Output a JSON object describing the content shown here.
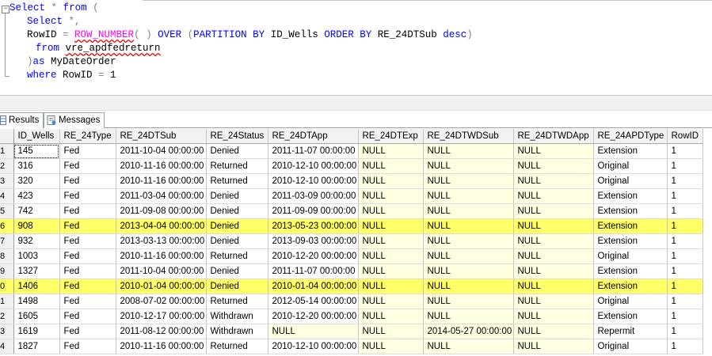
{
  "editor": {
    "lines": [
      {
        "indent": 0,
        "tokens": [
          {
            "t": "Select",
            "c": "kw"
          },
          {
            "t": " ",
            "c": ""
          },
          {
            "t": "*",
            "c": "op"
          },
          {
            "t": " ",
            "c": ""
          },
          {
            "t": "from",
            "c": "kw"
          },
          {
            "t": " ",
            "c": ""
          },
          {
            "t": "(",
            "c": "op"
          }
        ]
      },
      {
        "indent": 2,
        "tokens": [
          {
            "t": "Select",
            "c": "kw"
          },
          {
            "t": " ",
            "c": ""
          },
          {
            "t": "*,",
            "c": "op"
          }
        ]
      },
      {
        "indent": 2,
        "tokens": [
          {
            "t": "RowID ",
            "c": ""
          },
          {
            "t": "=",
            "c": "op"
          },
          {
            "t": " ",
            "c": ""
          },
          {
            "t": "ROW_NUMBER",
            "c": "fn sq"
          },
          {
            "t": "(",
            "c": "op"
          },
          {
            "t": " ",
            "c": ""
          },
          {
            "t": ")",
            "c": "op"
          },
          {
            "t": " ",
            "c": ""
          },
          {
            "t": "OVER",
            "c": "kw"
          },
          {
            "t": " ",
            "c": ""
          },
          {
            "t": "(",
            "c": "op"
          },
          {
            "t": "PARTITION BY",
            "c": "kw"
          },
          {
            "t": " ID_Wells ",
            "c": ""
          },
          {
            "t": "ORDER BY",
            "c": "kw"
          },
          {
            "t": " RE_24DTSub ",
            "c": ""
          },
          {
            "t": "desc",
            "c": "kw"
          },
          {
            "t": ")",
            "c": "op"
          }
        ]
      },
      {
        "indent": 3,
        "tokens": [
          {
            "t": "from",
            "c": "kw"
          },
          {
            "t": " ",
            "c": ""
          },
          {
            "t": "vre_apdfedreturn",
            "c": "sq"
          }
        ]
      },
      {
        "indent": 2,
        "tokens": [
          {
            "t": ")",
            "c": "op"
          },
          {
            "t": "as",
            "c": "kw"
          },
          {
            "t": " MyDateOrder",
            "c": ""
          }
        ]
      },
      {
        "indent": 2,
        "tokens": [
          {
            "t": "where",
            "c": "kw"
          },
          {
            "t": " RowID ",
            "c": ""
          },
          {
            "t": "=",
            "c": "op"
          },
          {
            "t": " 1",
            "c": ""
          }
        ]
      }
    ],
    "collapse_glyph": "−"
  },
  "tabs": [
    {
      "label": "Results",
      "icon": "results-grid-icon"
    },
    {
      "label": "Messages",
      "icon": "messages-icon"
    }
  ],
  "grid": {
    "columns": [
      "ID_Wells",
      "RE_24Type",
      "RE_24DTSub",
      "RE_24Status",
      "RE_24DTApp",
      "RE_24DTExp",
      "RE_24DTWDSub",
      "RE_24DTWDApp",
      "RE_24APDType",
      "RowID"
    ],
    "null_columns": [
      5,
      6,
      7
    ],
    "rows": [
      {
        "n": "1",
        "cells": [
          "145",
          "Fed",
          "2011-10-04 00:00:00",
          "Denied",
          "2011-11-07 00:00:00",
          "NULL",
          "NULL",
          "NULL",
          "Extension",
          "1"
        ]
      },
      {
        "n": "2",
        "cells": [
          "316",
          "Fed",
          "2010-11-16 00:00:00",
          "Returned",
          "2010-12-10 00:00:00",
          "NULL",
          "NULL",
          "NULL",
          "Original",
          "1"
        ]
      },
      {
        "n": "3",
        "cells": [
          "320",
          "Fed",
          "2010-11-16 00:00:00",
          "Returned",
          "2010-12-10 00:00:00",
          "NULL",
          "NULL",
          "NULL",
          "Original",
          "1"
        ]
      },
      {
        "n": "4",
        "cells": [
          "423",
          "Fed",
          "2011-03-04 00:00:00",
          "Denied",
          "2011-03-09 00:00:00",
          "NULL",
          "NULL",
          "NULL",
          "Extension",
          "1"
        ]
      },
      {
        "n": "5",
        "cells": [
          "742",
          "Fed",
          "2011-09-08 00:00:00",
          "Denied",
          "2011-09-09 00:00:00",
          "NULL",
          "NULL",
          "NULL",
          "Extension",
          "1"
        ]
      },
      {
        "n": "6",
        "cells": [
          "908",
          "Fed",
          "2013-04-04 00:00:00",
          "Denied",
          "2013-05-23 00:00:00",
          "NULL",
          "NULL",
          "NULL",
          "Extension",
          "1"
        ],
        "highlight": true
      },
      {
        "n": "7",
        "cells": [
          "932",
          "Fed",
          "2013-03-13 00:00:00",
          "Denied",
          "2013-09-03 00:00:00",
          "NULL",
          "NULL",
          "NULL",
          "Extension",
          "1"
        ]
      },
      {
        "n": "8",
        "cells": [
          "1003",
          "Fed",
          "2010-11-16 00:00:00",
          "Returned",
          "2010-12-20 00:00:00",
          "NULL",
          "NULL",
          "NULL",
          "Original",
          "1"
        ]
      },
      {
        "n": "9",
        "cells": [
          "1327",
          "Fed",
          "2011-10-04 00:00:00",
          "Denied",
          "2011-11-07 00:00:00",
          "NULL",
          "NULL",
          "NULL",
          "Extension",
          "1"
        ]
      },
      {
        "n": "0",
        "cells": [
          "1406",
          "Fed",
          "2010-01-04 00:00:00",
          "Denied",
          "2010-01-04 00:00:00",
          "NULL",
          "NULL",
          "NULL",
          "Extension",
          "1"
        ],
        "highlight": true
      },
      {
        "n": "1",
        "cells": [
          "1498",
          "Fed",
          "2008-07-02 00:00:00",
          "Returned",
          "2012-05-14 00:00:00",
          "NULL",
          "NULL",
          "NULL",
          "Original",
          "1"
        ]
      },
      {
        "n": "2",
        "cells": [
          "1605",
          "Fed",
          "2010-12-17 00:00:00",
          "Withdrawn",
          "2010-12-20 00:00:00",
          "NULL",
          "NULL",
          "NULL",
          "Extension",
          "1"
        ]
      },
      {
        "n": "3",
        "cells": [
          "1619",
          "Fed",
          "2011-08-12 00:00:00",
          "Withdrawn",
          "NULL",
          "NULL",
          "2014-05-27 00:00:00",
          "NULL",
          "Repermit",
          "1"
        ]
      },
      {
        "n": "4",
        "cells": [
          "1827",
          "Fed",
          "2010-11-16 00:00:00",
          "Returned",
          "2010-12-10 00:00:00",
          "NULL",
          "NULL",
          "NULL",
          "Original",
          "1"
        ]
      }
    ]
  },
  "colors": {
    "keyword": "#0000ff",
    "function": "#ff00ff",
    "operator": "#808080",
    "null_cell": "#ffffe1",
    "row_highlight": "#ffff66"
  }
}
